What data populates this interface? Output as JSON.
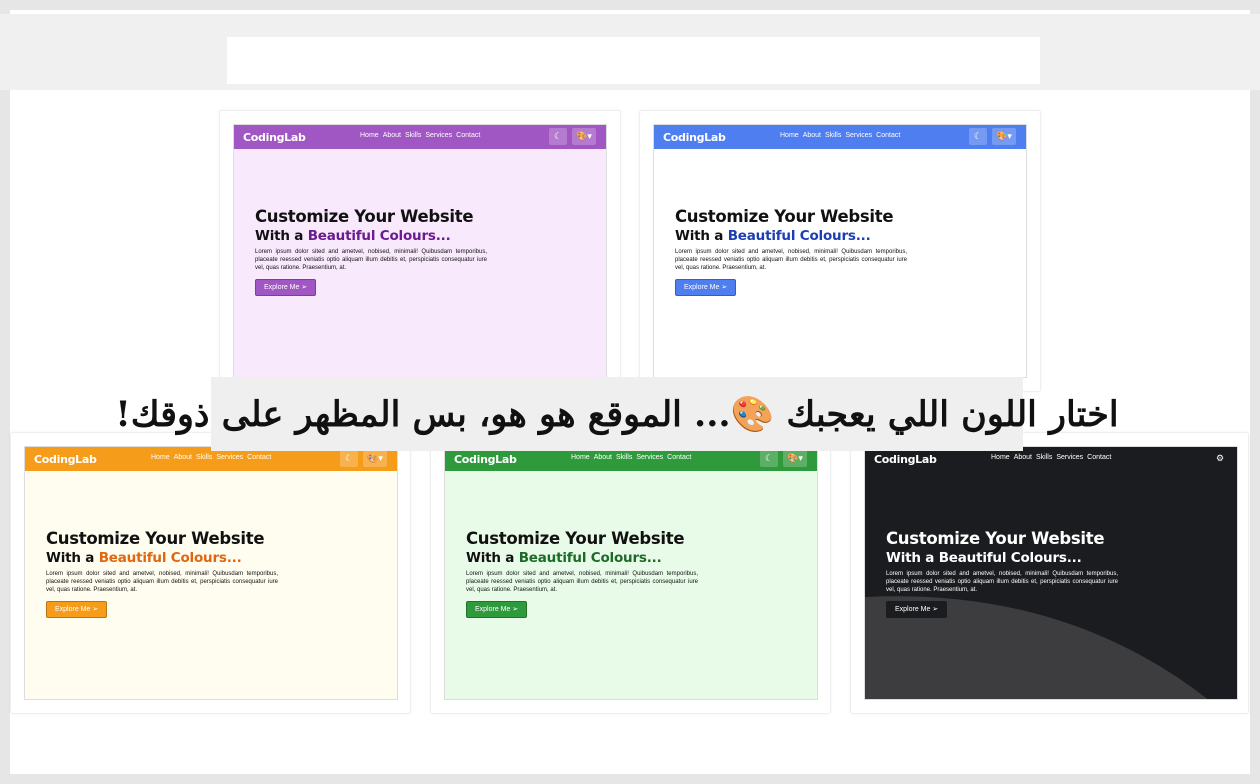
{
  "caption": "اختار اللون اللي يعجبك 🎨... الموقع هو هو، بس المظهر على ذوقك!",
  "preview": {
    "logo": "CodingLab",
    "nav_links": [
      "Home",
      "About",
      "Skills",
      "Services",
      "Contact"
    ],
    "hero_title": "Customize Your Website",
    "hero_subtitle_prefix": "With a ",
    "hero_subtitle_highlight": "Beautiful Colours...",
    "hero_text": "Lorem ipsum dolor sited and ametvel, nobised, minimali! Quibusdam temporibus, placeate reessed veniatis optio aliquam illum debitis et, perspiciatis consequatur iure vel, quas ratione. Praesentium, at.",
    "button_label": "Explore Me ➢",
    "moon_glyph": "☾",
    "palette_glyph": "🎨▾",
    "gear_glyph": "⚙"
  },
  "themes": [
    {
      "name": "purple",
      "nav": "#a057c4",
      "bg": "#f8e9fc",
      "accent": "#6a1b8f",
      "button": "#a057c4"
    },
    {
      "name": "blue",
      "nav": "#4f7ef0",
      "bg": "#ffffff",
      "accent": "#1d3fb5",
      "button": "#4f7ef0"
    },
    {
      "name": "orange",
      "nav": "#f59c1b",
      "bg": "#fffdf0",
      "accent": "#e1660e",
      "button": "#f59c1b"
    },
    {
      "name": "green",
      "nav": "#2f9a3c",
      "bg": "#e8fbe9",
      "accent": "#1c6b27",
      "button": "#2f9a3c"
    },
    {
      "name": "dark",
      "nav": "#1b1c1f",
      "bg": "#1b1c1f",
      "accent": "#ffffff",
      "button": "#1b1c1f"
    }
  ]
}
